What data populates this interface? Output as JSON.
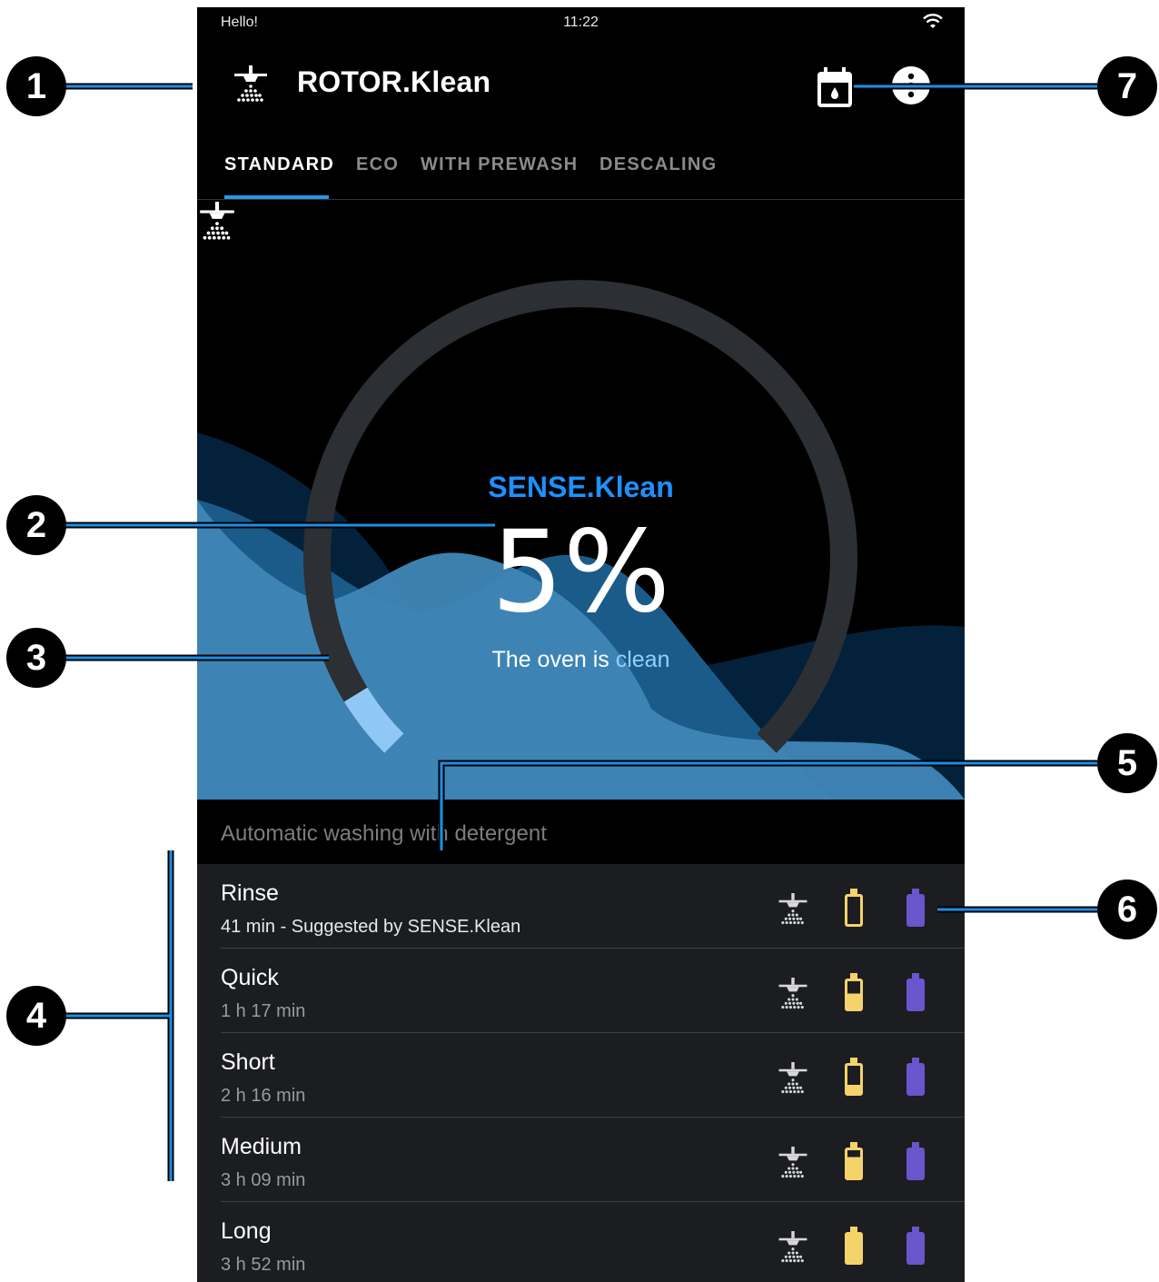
{
  "status_bar": {
    "greeting": "Hello!",
    "time": "11:22",
    "wifi_icon": "wifi-icon"
  },
  "app_bar": {
    "title": "ROTOR.Klean",
    "logo_icon": "rotor-shower-icon",
    "calendar_icon": "calendar-water-drop-icon",
    "menu_icon": "more-vertical-icon"
  },
  "tabs": [
    {
      "label": "STANDARD",
      "active": true
    },
    {
      "label": "ECO",
      "active": false
    },
    {
      "label": "WITH PREWASH",
      "active": false
    },
    {
      "label": "DESCALING",
      "active": false
    }
  ],
  "gauge": {
    "title": "SENSE.Klean",
    "value": "5%",
    "fraction": 0.05,
    "status_prefix": "The oven is",
    "status_word": "clean",
    "icon": "rotor-shower-icon"
  },
  "section": {
    "title": "Automatic washing with detergent"
  },
  "programs": [
    {
      "name": "Rinse",
      "detail": "41 min - Suggested by SENSE.Klean",
      "yellow_level": 0.0,
      "suggested": true
    },
    {
      "name": "Quick",
      "detail": "1 h 17 min",
      "yellow_level": 0.55,
      "suggested": false
    },
    {
      "name": "Short",
      "detail": "2 h 16 min",
      "yellow_level": 0.3,
      "suggested": false
    },
    {
      "name": "Medium",
      "detail": "3 h 09 min",
      "yellow_level": 0.75,
      "suggested": false
    },
    {
      "name": "Long",
      "detail": "3 h 52 min",
      "yellow_level": 1.0,
      "suggested": false
    }
  ],
  "annotations": [
    "1",
    "2",
    "3",
    "4",
    "5",
    "6",
    "7"
  ],
  "colors": {
    "accent": "#1e90ff",
    "tab_indicator": "#2a96e8",
    "clean_highlight": "#8fd0ff",
    "gauge_track": "#2c2f33",
    "gauge_fill": "#90c8f5",
    "detergent_yellow": "#f5d36b",
    "detergent_purple": "#6a55cc",
    "callout_blue": "#1a8fe8"
  }
}
